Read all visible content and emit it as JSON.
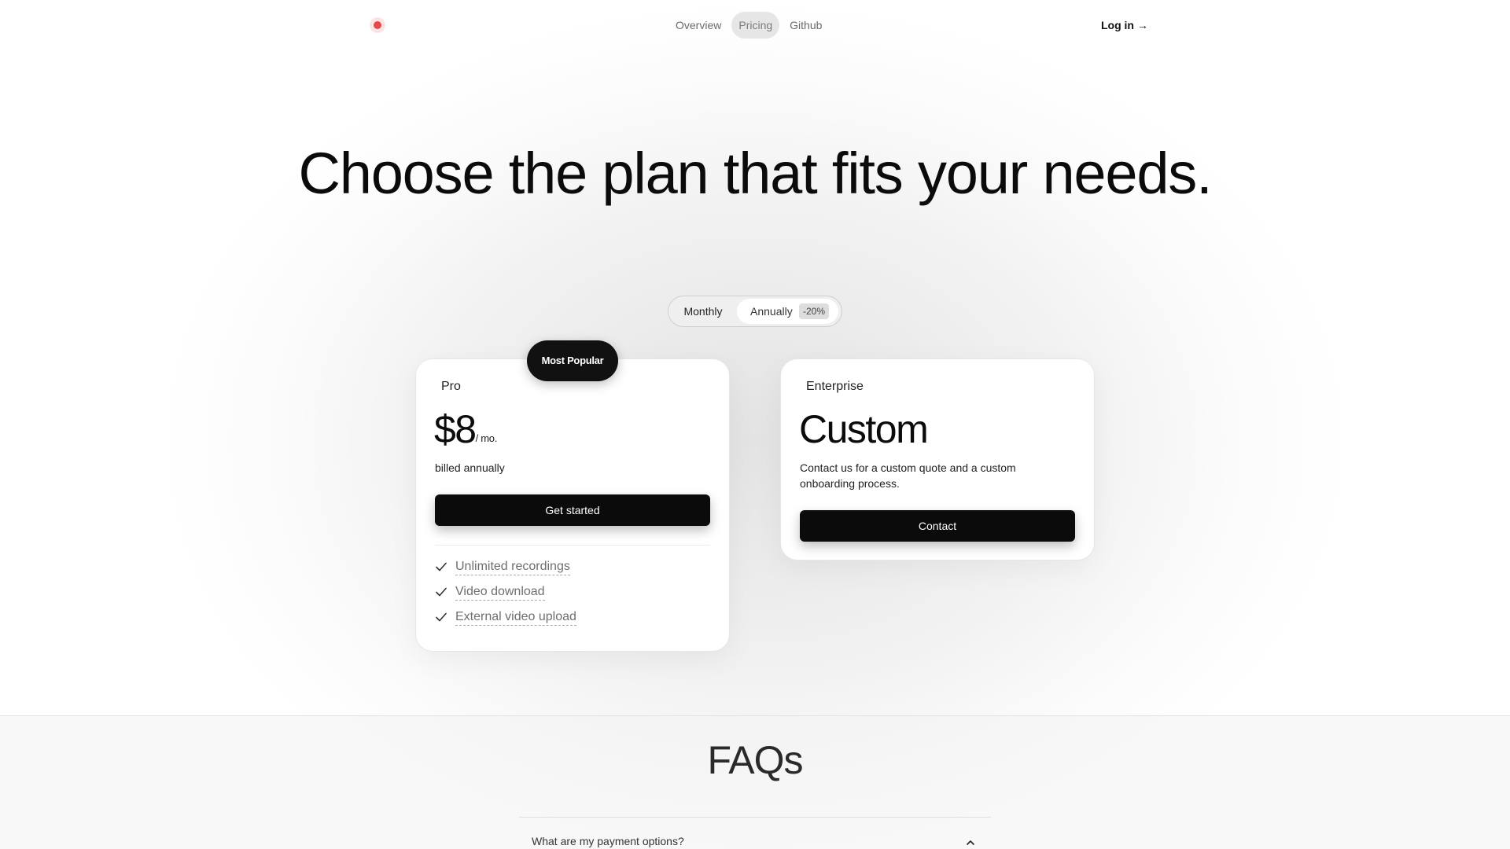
{
  "header": {
    "logo_icon": "red-dot-logo",
    "nav": [
      {
        "label": "Overview",
        "active": false
      },
      {
        "label": "Pricing",
        "active": true
      },
      {
        "label": "Github",
        "active": false
      }
    ],
    "login_label": "Log in →"
  },
  "hero": {
    "title": "Choose the plan that fits your needs."
  },
  "billing_toggle": {
    "monthly_label": "Monthly",
    "annually_label": "Annually",
    "discount_badge": "-20%",
    "selected": "Annually"
  },
  "plans": {
    "pro": {
      "badge": "Most Popular",
      "name": "Pro",
      "price": "$8",
      "period": "/ mo.",
      "billing_note": "billed annually",
      "cta_label": "Get started",
      "features": [
        "Unlimited recordings",
        "Video download",
        "External video upload"
      ]
    },
    "enterprise": {
      "name": "Enterprise",
      "price": "Custom",
      "description": "Contact us for a custom quote and a custom onboarding process.",
      "cta_label": "Contact"
    }
  },
  "faq": {
    "title": "FAQs",
    "items": [
      {
        "question": "What are my payment options?",
        "expanded": true
      }
    ]
  },
  "colors": {
    "brand_dot": "#e5484d",
    "primary_button": "#0b0b0b",
    "accent_text": "#111111"
  }
}
